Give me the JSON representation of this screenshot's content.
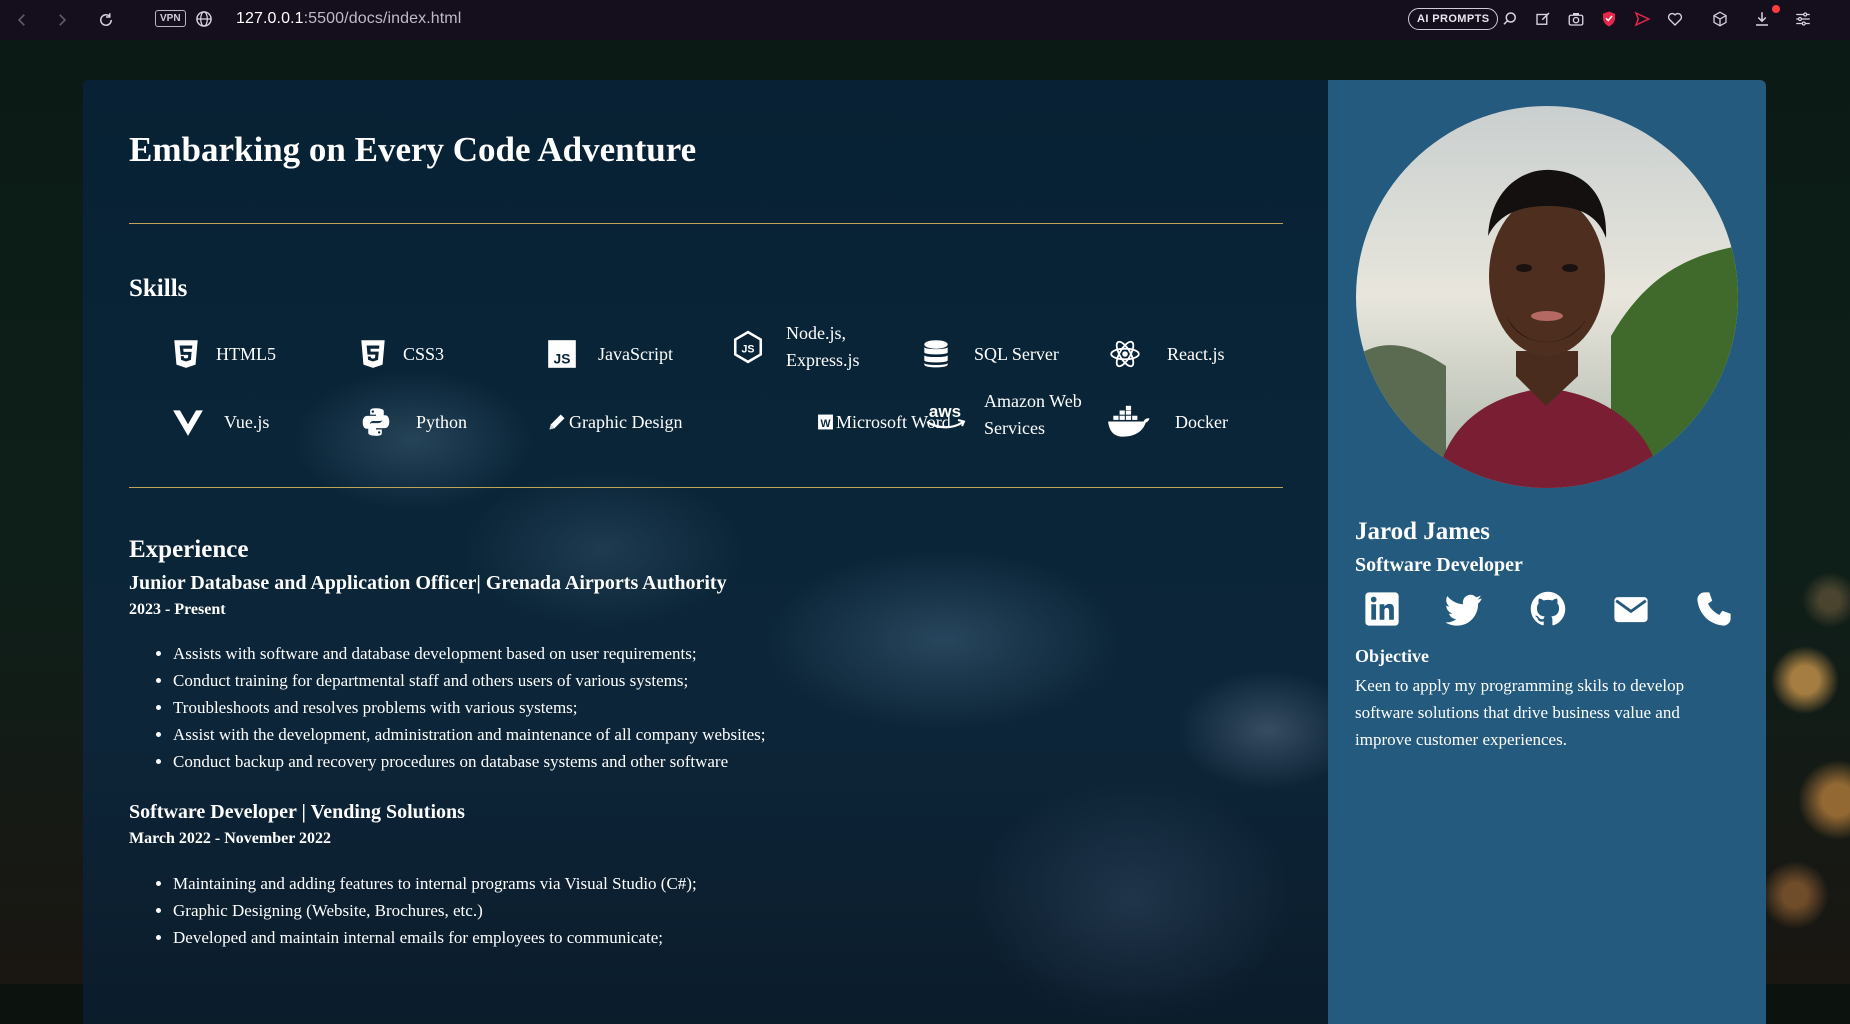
{
  "browser": {
    "vpn_label": "VPN",
    "url_host": "127.0.0.1",
    "url_path": ":5500/docs/index.html",
    "ai_prompts_label": "AI PROMPTS"
  },
  "header": {
    "title": "Embarking on Every Code Adventure"
  },
  "skills": {
    "heading": "Skills",
    "items": [
      {
        "label": "HTML5",
        "icon": "html5-icon"
      },
      {
        "label": "CSS3",
        "icon": "css3-icon"
      },
      {
        "label": "JavaScript",
        "icon": "javascript-icon"
      },
      {
        "label": "Node.js,",
        "label2": "Express.js",
        "icon": "nodejs-icon"
      },
      {
        "label": "SQL Server",
        "icon": "database-icon"
      },
      {
        "label": "React.js",
        "icon": "react-icon"
      },
      {
        "label": "Vue.js",
        "icon": "vue-icon"
      },
      {
        "label": "Python",
        "icon": "python-icon"
      },
      {
        "label": "Graphic Design",
        "icon": "pencil-icon"
      },
      {
        "label": "Microsoft Word",
        "icon": "word-icon"
      },
      {
        "label": "Amazon Web",
        "label2": "Services",
        "icon": "aws-icon"
      },
      {
        "label": "Docker",
        "icon": "docker-icon"
      }
    ]
  },
  "experience": {
    "heading": "Experience",
    "jobs": [
      {
        "title": "Junior Database and Application Officer| Grenada Airports Authority",
        "dates": "2023 - Present",
        "duties": [
          "Assists with software and database development based on user requirements;",
          "Conduct training for departmental staff and others users of various systems;",
          "Troubleshoots and resolves problems with various systems;",
          "Assist with the development, administration and maintenance of all company websites;",
          "Conduct backup and recovery procedures on database systems and other software"
        ]
      },
      {
        "title": "Software Developer | Vending Solutions",
        "dates": "March 2022 - November 2022",
        "duties": [
          "Maintaining and adding features to internal programs via Visual Studio (C#);",
          "Graphic Designing (Website, Brochures, etc.)",
          "Developed and maintain internal emails for employees to communicate;"
        ]
      }
    ]
  },
  "profile": {
    "name": "Jarod James",
    "role": "Software Developer",
    "socials": [
      "linkedin-icon",
      "twitter-icon",
      "github-icon",
      "email-icon",
      "phone-icon"
    ],
    "objective_heading": "Objective",
    "objective_text": "Keen to apply my programming skils to develop software solutions that drive business value and improve customer experiences."
  },
  "colors": {
    "main_bg": "#0a2538",
    "sidebar_bg": "#235a7e",
    "rule": "#bfa35a",
    "chrome_bg": "#150f1d"
  }
}
